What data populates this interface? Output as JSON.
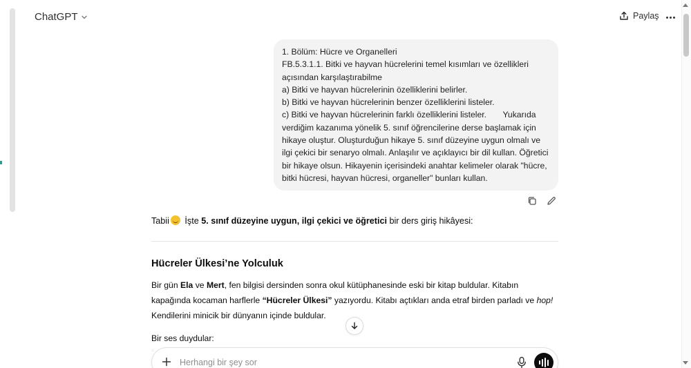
{
  "header": {
    "model_name": "ChatGPT",
    "share_label": "Paylaş"
  },
  "user_message": {
    "lines": [
      "1. Bölüm: Hücre ve Organelleri",
      "FB.5.3.1.1. Bitki ve hayvan hücrelerini temel kısımları ve özellikleri",
      "açısından karşılaştırabilme",
      "a) Bitki ve hayvan hücrelerinin özelliklerini belirler.",
      "b) Bitki ve hayvan hücrelerinin benzer özelliklerini listeler.",
      "c) Bitki ve hayvan hücrelerinin farklı özelliklerini listeler.       Yukarıda",
      "verdiğim kazanıma yönelik 5. sınıf öğrencilerine derse başlamak için",
      "hikaye oluştur. Oluşturduğun hikaye 5. sınıf düzeyine uygun olmalı ve",
      "ilgi çekici bir senaryo olmalı. Anlaşılır ve açıklayıcı bir dil kullan. Öğretici",
      "bir hikaye olsun. Hikayenin içerisindeki anahtar kelimeler olarak \"hücre,",
      "bitki hücresi, hayvan hücresi, organeller\" bunları kullan."
    ]
  },
  "assistant_reply": {
    "intro_prefix": "Tabii",
    "intro_mid": " İşte ",
    "intro_bold": "5. sınıf düzeyine uygun, ilgi çekici ve öğretici",
    "intro_suffix": " bir ders giriş hikâyesi:",
    "story_title": "Hücreler Ülkesi’ne Yolculuk",
    "para1": {
      "t1": "Bir gün ",
      "b1": "Ela",
      "t2": " ve ",
      "b2": "Mert",
      "t3": ", fen bilgisi dersinden sonra okul kütüphanesinde eski bir kitap buldular. Kitabın kapağında kocaman harflerle ",
      "b3": "“Hücreler Ülkesi”",
      "t4": " yazıyordu. Kitabı açtıkları anda etraf birden parladı ve ",
      "i1": "hop!",
      "t5": " Kendilerini minicik bir dünyanın içinde buldular."
    },
    "para2": "Bir ses duydular:",
    "quote_start": "“"
  },
  "composer": {
    "placeholder": "Herhangi bir şey sor"
  },
  "icons": {
    "chevron": "chevron-down-icon",
    "share": "share-icon",
    "more": "more-icon",
    "copy": "copy-icon",
    "edit": "edit-icon",
    "scroll_down": "arrow-down-icon",
    "plus": "plus-icon",
    "mic": "mic-icon",
    "voice": "voice-mode-icon"
  }
}
